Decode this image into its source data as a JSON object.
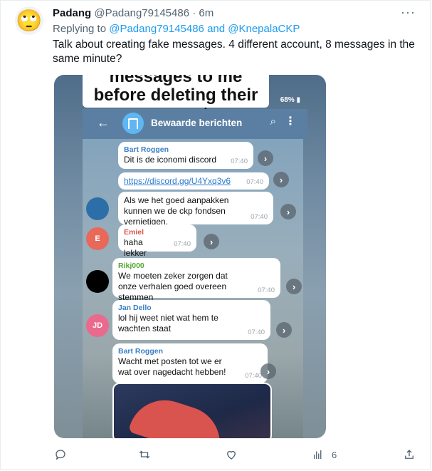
{
  "author": {
    "avatar_emoji": "🙄",
    "name": "Padang",
    "handle": "@Padang79145486",
    "time": "· 6m"
  },
  "more_label": "···",
  "reply": {
    "prefix": "Replying to ",
    "mentions": "@Padang79145486 and @KnepalaCKP"
  },
  "tweet_text": "Talk about creating fake messages.  4 different account, 8 messages in the same minute?",
  "media": {
    "caption": "messages to me before deleting their account",
    "status": "68%",
    "chat": {
      "back": "←",
      "title": "Bewaarde berichten",
      "search": "⌕",
      "menu": "⋮",
      "messages": [
        {
          "sender": "Bart Roggen",
          "text": "Dit is de iconomi discord",
          "time": "07:40",
          "sender_color": "#3a7fc4"
        },
        {
          "sender": "",
          "text": "https://discord.gg/U4Yxq3v6",
          "time": "07:40",
          "sender_color": ""
        },
        {
          "sender": "",
          "text": "Als we het goed aanpakken kunnen we de ckp fondsen vernietigen.",
          "time": "07:40",
          "sender_color": ""
        },
        {
          "sender": "Emiel",
          "text": "haha lekker",
          "time": "07:40",
          "sender_color": "#d9534f"
        },
        {
          "sender": "Rikj000",
          "text": "We moeten zeker zorgen dat onze verhalen goed overeen stemmen",
          "time": "07:40",
          "sender_color": "#55a630"
        },
        {
          "sender": "Jan Dello",
          "text": "lol hij weet niet wat hem te wachten staat",
          "time": "07:40",
          "sender_color": "#3a7fc4"
        },
        {
          "sender": "Bart Roggen",
          "text": "Wacht met posten tot we er wat over nagedacht hebben!",
          "time": "07:40",
          "sender_color": "#3a7fc4"
        }
      ],
      "avatars": [
        {
          "initials": "",
          "color": "#2c6fa8"
        },
        {
          "initials": "E",
          "color": "#e8685a"
        },
        {
          "initials": "",
          "color": "#000000"
        },
        {
          "initials": "JD",
          "color": "#e96a8d"
        }
      ]
    }
  },
  "actions": {
    "reply_icon": "reply-icon",
    "retweet_icon": "retweet-icon",
    "like_icon": "like-icon",
    "views_icon": "views-icon",
    "views_count": "6",
    "share_icon": "share-icon"
  }
}
